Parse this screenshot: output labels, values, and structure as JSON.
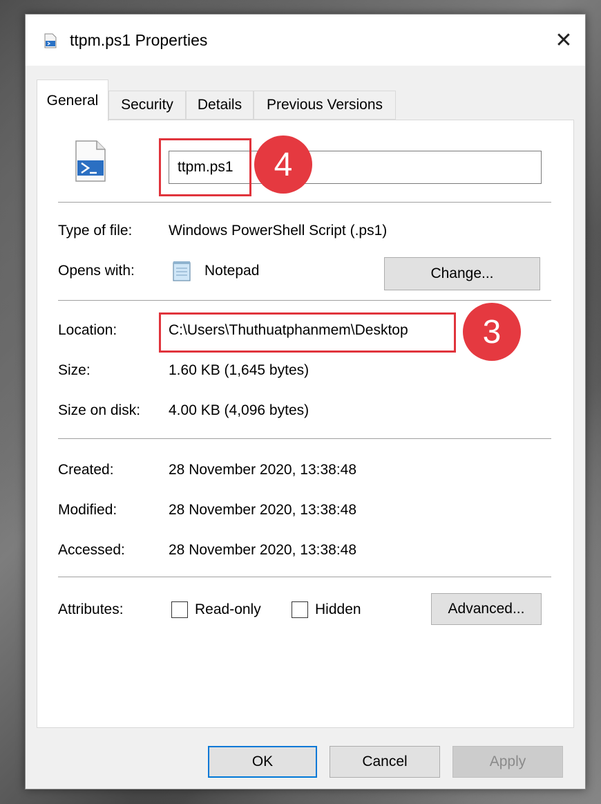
{
  "window": {
    "title": "ttpm.ps1 Properties",
    "close_glyph": "✕"
  },
  "tabs": [
    {
      "label": "General",
      "active": true
    },
    {
      "label": "Security",
      "active": false
    },
    {
      "label": "Details",
      "active": false
    },
    {
      "label": "Previous Versions",
      "active": false
    }
  ],
  "general": {
    "file_name": "ttpm.ps1",
    "type_label": "Type of file:",
    "type_value": "Windows PowerShell Script (.ps1)",
    "opens_label": "Opens with:",
    "opens_value": "Notepad",
    "change_button": "Change...",
    "location_label": "Location:",
    "location_value": "C:\\Users\\Thuthuatphanmem\\Desktop",
    "size_label": "Size:",
    "size_value": "1.60 KB (1,645 bytes)",
    "size_on_disk_label": "Size on disk:",
    "size_on_disk_value": "4.00 KB (4,096 bytes)",
    "created_label": "Created:",
    "created_value": "28 November 2020, 13:38:48",
    "modified_label": "Modified:",
    "modified_value": "28 November 2020, 13:38:48",
    "accessed_label": "Accessed:",
    "accessed_value": "28 November 2020, 13:38:48",
    "attributes_label": "Attributes:",
    "readonly_label": "Read-only",
    "readonly_checked": false,
    "hidden_label": "Hidden",
    "hidden_checked": false,
    "advanced_button": "Advanced..."
  },
  "annotations": {
    "badge_name": "4",
    "badge_location": "3",
    "highlight_color": "#e0343c"
  },
  "footer": {
    "ok": "OK",
    "cancel": "Cancel",
    "apply": "Apply"
  },
  "icons": {
    "title": "powershell-file-icon",
    "file": "powershell-script-icon",
    "notepad": "notepad-icon",
    "close": "close-icon"
  }
}
